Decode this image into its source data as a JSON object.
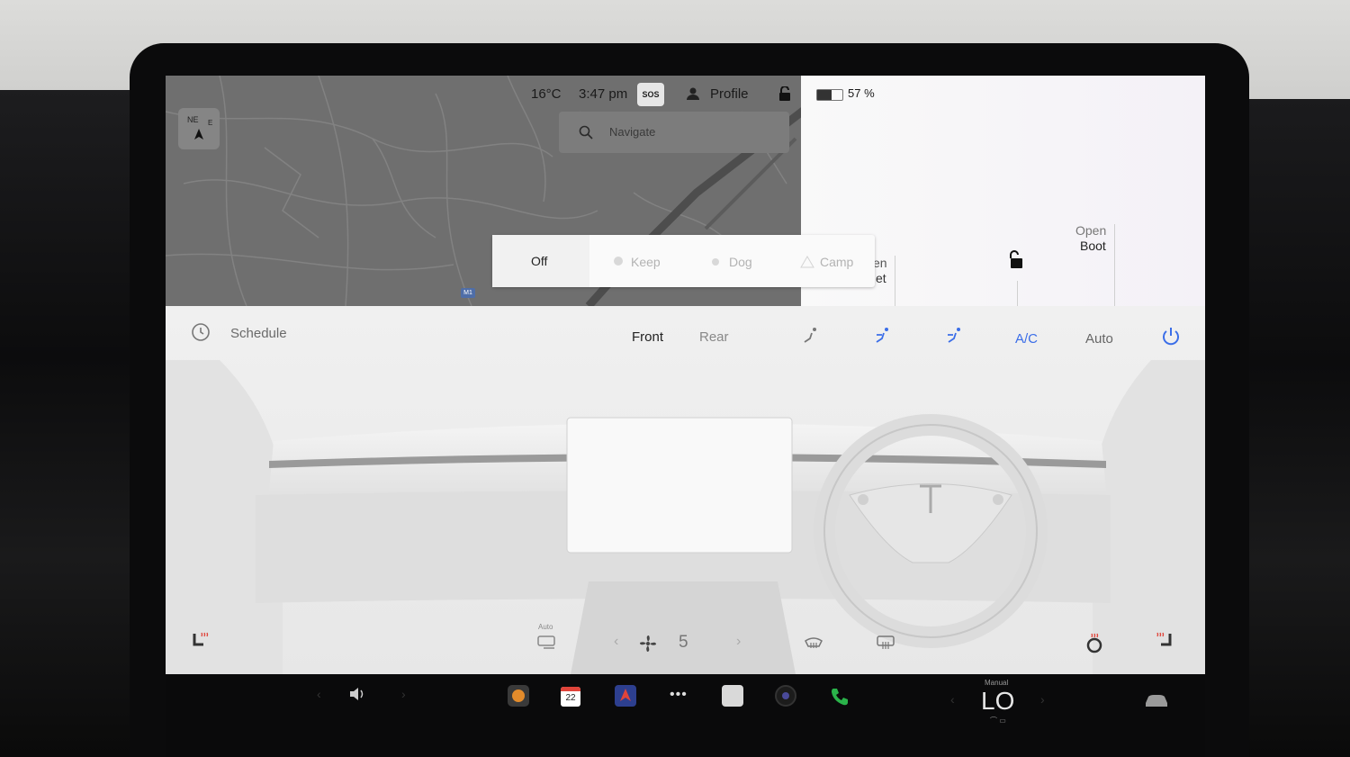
{
  "status_bar": {
    "temperature": "16°C",
    "time": "3:47 pm",
    "sos_label": "SOS",
    "profile_label": "Profile",
    "battery_percent": "57 %",
    "battery_level": 0.57
  },
  "map": {
    "search_placeholder": "Navigate",
    "compass_label": "NE",
    "compass_east": "E",
    "road_marker": "M1"
  },
  "mode_selector": {
    "options": [
      "Off",
      "Keep",
      "Dog",
      "Camp"
    ],
    "selected": "Off"
  },
  "vehicle_panel": {
    "partial_frunk_line1": "en",
    "partial_frunk_line2": "et",
    "boot_line1": "Open",
    "boot_line2": "Boot"
  },
  "climate": {
    "schedule_label": "Schedule",
    "front_label": "Front",
    "rear_label": "Rear",
    "ac_label": "A/C",
    "auto_label": "Auto",
    "auto_small_label": "Auto",
    "fan_speed": "5",
    "accent_color": "#3b6ee8",
    "seat_heat_color": "#e0443a"
  },
  "taskbar": {
    "calendar_day": "22",
    "temp_mode": "Manual",
    "temp_value": "LO"
  }
}
